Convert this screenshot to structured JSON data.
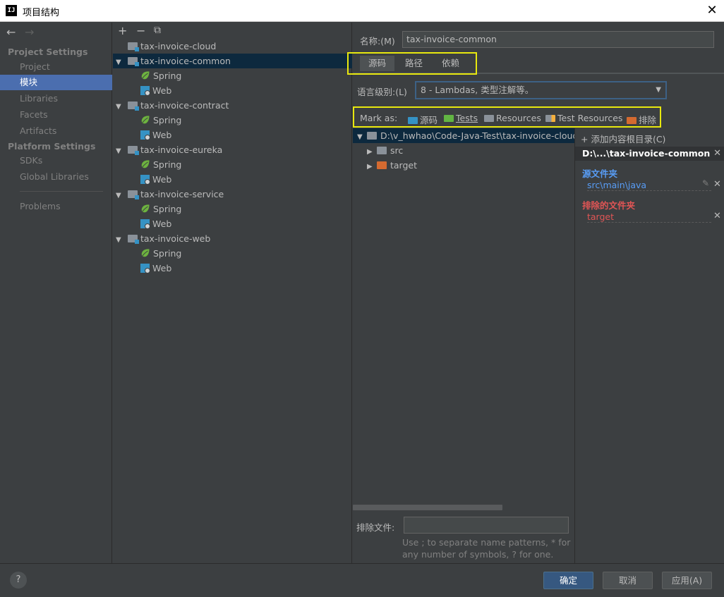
{
  "window": {
    "title": "项目结构",
    "app_icon": "IJ"
  },
  "nav": {
    "back_icon": "←",
    "forward_icon": "→",
    "groups": [
      {
        "label": "Project Settings",
        "items": [
          {
            "label": "Project"
          },
          {
            "label": "模块",
            "selected": true
          },
          {
            "label": "Libraries"
          },
          {
            "label": "Facets"
          },
          {
            "label": "Artifacts"
          }
        ]
      },
      {
        "label": "Platform Settings",
        "items": [
          {
            "label": "SDKs"
          },
          {
            "label": "Global Libraries"
          }
        ]
      }
    ],
    "problems": "Problems"
  },
  "toolbar": {
    "add": "+",
    "remove": "−",
    "copy": "⧉"
  },
  "modules": [
    {
      "name": "tax-invoice-cloud",
      "expanded": false,
      "children": []
    },
    {
      "name": "tax-invoice-common",
      "expanded": true,
      "selected": true,
      "children": [
        "Spring",
        "Web"
      ]
    },
    {
      "name": "tax-invoice-contract",
      "expanded": true,
      "children": [
        "Spring",
        "Web"
      ]
    },
    {
      "name": "tax-invoice-eureka",
      "expanded": true,
      "children": [
        "Spring",
        "Web"
      ]
    },
    {
      "name": "tax-invoice-service",
      "expanded": true,
      "children": [
        "Spring",
        "Web"
      ]
    },
    {
      "name": "tax-invoice-web",
      "expanded": true,
      "children": [
        "Spring",
        "Web"
      ]
    }
  ],
  "settings": {
    "name_label": "名称:(M)",
    "name_value": "tax-invoice-common",
    "tabs": [
      "源码",
      "路径",
      "依赖"
    ],
    "lang_label": "语言级别:(L)",
    "lang_value": "8 - Lambdas, 类型注解等。",
    "mark_as": {
      "label": "Mark as:",
      "sources": "源码",
      "tests": "Tests",
      "resources": "Resources",
      "test_resources": "Test Resources",
      "excluded": "排除"
    },
    "content_tree": {
      "root": "D:\\v_hwhao\\Code-Java-Test\\tax-invoice-cloud-C",
      "children": [
        "src",
        "target"
      ]
    },
    "exclude_label": "排除文件:",
    "exclude_value": "",
    "exclude_hint": "Use ; to separate name patterns, * for any number of symbols, ? for one."
  },
  "roots": {
    "add_label": "添加内容根目录(C)",
    "header": "D:\\...\\tax-invoice-common",
    "source_title": "源文件夹",
    "source_path": "src\\main\\java",
    "excluded_title": "排除的文件夹",
    "excluded_path": "target"
  },
  "buttons": {
    "ok": "确定",
    "cancel": "取消",
    "apply": "应用(A)",
    "help": "?"
  },
  "colors": {
    "background": "#3c3f41",
    "selection": "#4b6eaf",
    "tree_selection": "#0d293e",
    "highlight_box": "#e8e80e",
    "source_blue": "#589df6",
    "excluded_red": "#e05555"
  }
}
